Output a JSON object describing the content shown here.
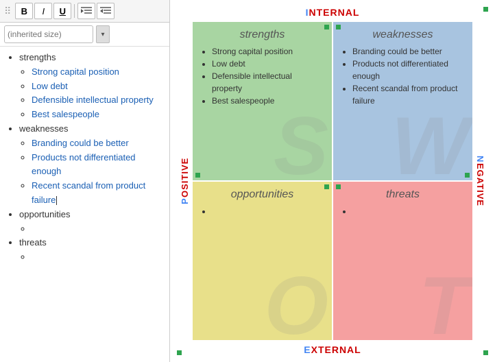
{
  "toolbar": {
    "drag_handle": "⠿",
    "bold_label": "B",
    "italic_label": "I",
    "underline_label": "U",
    "indent_label": "⇥",
    "outdent_label": "⇤",
    "font_size_placeholder": "(inherited size)",
    "dropdown_arrow": "▾"
  },
  "editor": {
    "items": [
      {
        "label": "strengths",
        "children": [
          "Strong capital position",
          "Low debt",
          "Defensible intellectual property",
          "Best salespeople"
        ]
      },
      {
        "label": "weaknesses",
        "children": [
          "Branding could be better",
          "Products not differentiated enough",
          "Recent scandal from product failure"
        ]
      },
      {
        "label": "opportunities",
        "children": []
      },
      {
        "label": "threats",
        "children": []
      }
    ]
  },
  "swot": {
    "label_internal": "INTERNAL",
    "label_internal_first": "I",
    "label_internal_rest": "NTERNAL",
    "label_external": "EXTERNAL",
    "label_external_first": "E",
    "label_external_rest": "XTERNAL",
    "label_positive": "POSITIVE",
    "label_positive_first": "P",
    "label_positive_rest": "OSITIVE",
    "label_negative": "NEGATIVE",
    "label_negative_first": "N",
    "label_negative_rest": "EGATIVE",
    "cells": {
      "strengths": {
        "title": "strengths",
        "bg_letter": "S",
        "items": [
          "Strong capital position",
          "Low debt",
          "Defensible intellectual property",
          "Best salespeople"
        ]
      },
      "weaknesses": {
        "title": "weaknesses",
        "bg_letter": "W",
        "items": [
          "Branding could be better",
          "Products not differentiated enough",
          "Recent scandal from product failure"
        ]
      },
      "opportunities": {
        "title": "opportunities",
        "bg_letter": "O",
        "items": []
      },
      "threats": {
        "title": "threats",
        "bg_letter": "T",
        "items": []
      }
    }
  }
}
